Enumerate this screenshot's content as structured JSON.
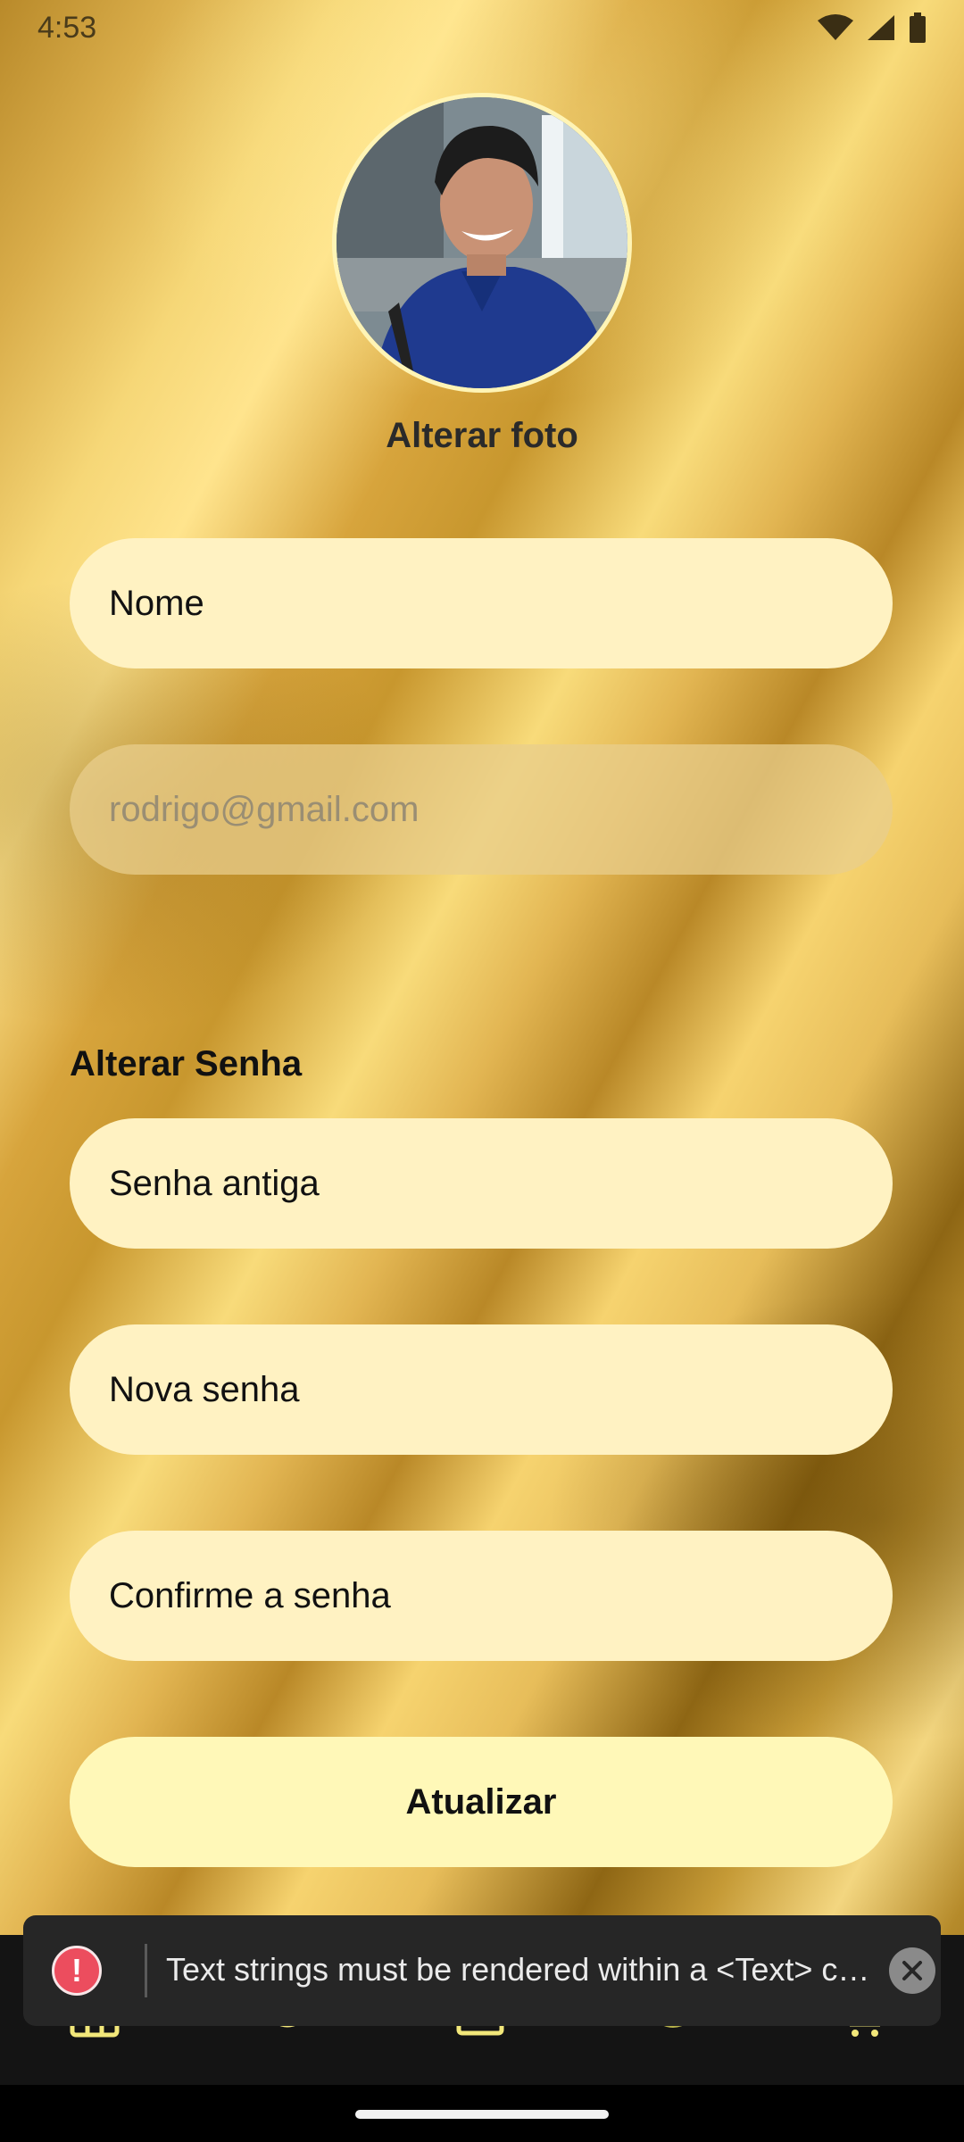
{
  "status_bar": {
    "time": "4:53"
  },
  "profile": {
    "change_photo_label": "Alterar foto"
  },
  "form": {
    "name_placeholder": "Nome",
    "email_value": "rodrigo@gmail.com",
    "password_section_title": "Alterar Senha",
    "old_password_placeholder": "Senha antiga",
    "new_password_placeholder": "Nova senha",
    "confirm_password_placeholder": "Confirme a senha",
    "update_button_label": "Atualizar"
  },
  "toast": {
    "message": "Text strings must be rendered within a <Text> c…"
  },
  "colors": {
    "field_background": "#fff2c2",
    "button_background": "#fff8b8",
    "error": "#ec4d5e",
    "nav_active": "#b8b34a",
    "nav_inactive": "#f2e77a"
  },
  "bottom_nav": {
    "items": [
      {
        "icon": "grid-icon"
      },
      {
        "icon": "clock-icon"
      },
      {
        "icon": "calendar-icon"
      },
      {
        "icon": "profile-icon"
      },
      {
        "icon": "cart-icon"
      }
    ]
  }
}
